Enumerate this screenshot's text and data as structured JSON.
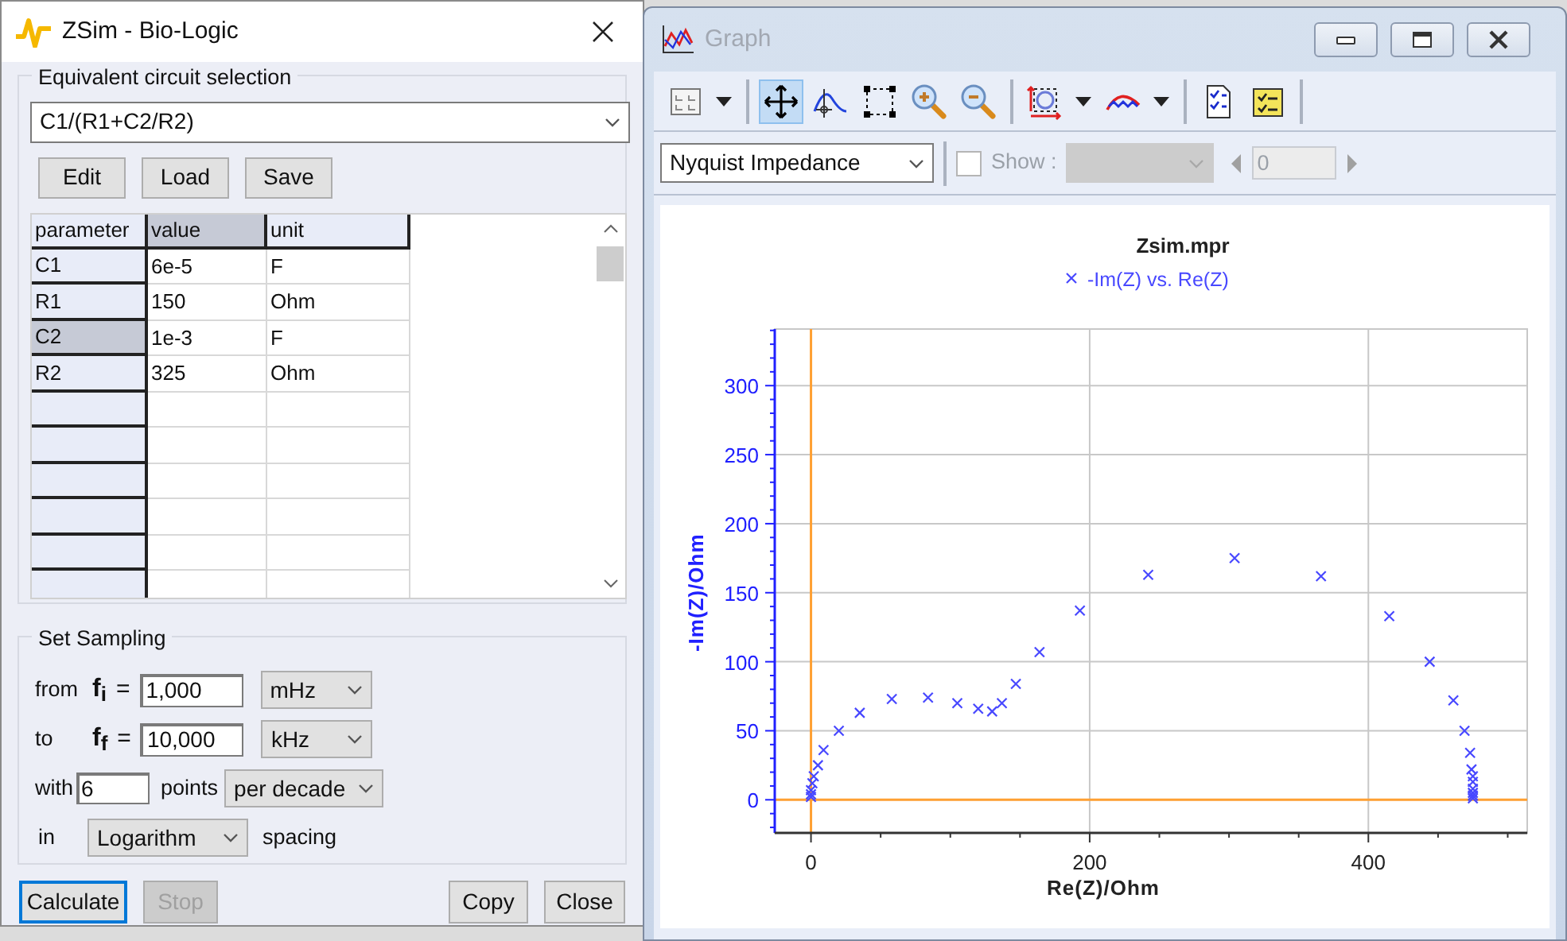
{
  "zsim_window": {
    "title": "ZSim - Bio-Logic",
    "circuit_group": {
      "label": "Equivalent circuit selection",
      "circuit": "C1/(R1+C2/R2)",
      "buttons": [
        "Edit",
        "Load",
        "Save"
      ]
    },
    "table": {
      "columns": [
        {
          "label": "parameter",
          "selected": false
        },
        {
          "label": "value",
          "selected": true
        },
        {
          "label": "unit",
          "selected": false
        }
      ],
      "rows": [
        {
          "parameter": "C1",
          "value": "6e-5",
          "unit": "F",
          "selected": false
        },
        {
          "parameter": "R1",
          "value": "150",
          "unit": "Ohm",
          "selected": false
        },
        {
          "parameter": "C2",
          "value": "1e-3",
          "unit": "F",
          "selected": true
        },
        {
          "parameter": "R2",
          "value": "325",
          "unit": "Ohm",
          "selected": false
        }
      ]
    },
    "sampling": {
      "label": "Set Sampling",
      "frequency_rows": [
        {
          "label": "from",
          "variable": "f",
          "index": "i",
          "equals": "=",
          "value": "1,000",
          "unit": "mHz"
        },
        {
          "label": "to",
          "variable": "f",
          "index": "f",
          "equals": "=",
          "value": "10,000",
          "unit": "kHz"
        }
      ],
      "points_row": {
        "label": "with",
        "value": "6",
        "unit_label": "points",
        "mode": "per decade"
      },
      "spacing_row": {
        "label": "in",
        "value": "Logarithm",
        "suffix": "spacing"
      }
    },
    "footer_buttons": [
      {
        "label": "Calculate",
        "focused": true,
        "disabled": false
      },
      {
        "label": "Stop",
        "focused": false,
        "disabled": true
      },
      {
        "label": "Copy",
        "focused": false,
        "disabled": false
      },
      {
        "label": "Close",
        "focused": false,
        "disabled": false
      }
    ]
  },
  "graph_window": {
    "title": "Graph",
    "tool_groups": [
      [
        {
          "kind": "layout",
          "dropdown": true,
          "selected": false
        }
      ],
      [
        {
          "kind": "move",
          "dropdown": false,
          "selected": true
        },
        {
          "kind": "cursor",
          "dropdown": false,
          "selected": false
        },
        {
          "kind": "select",
          "dropdown": false,
          "selected": false
        },
        {
          "kind": "zoom_in",
          "dropdown": false,
          "selected": false
        },
        {
          "kind": "zoom_out",
          "dropdown": false,
          "selected": false
        }
      ],
      [
        {
          "kind": "autoscale",
          "dropdown": true,
          "selected": false
        },
        {
          "kind": "fit",
          "dropdown": true,
          "selected": false
        }
      ],
      [
        {
          "kind": "report",
          "dropdown": false,
          "selected": false
        },
        {
          "kind": "checklist",
          "dropdown": false,
          "selected": false
        }
      ]
    ],
    "plot_type": "Nyquist Impedance",
    "show": {
      "label": "Show :",
      "checked": false
    },
    "show_spinner": {
      "value": "0",
      "disabled": true
    },
    "chart": {
      "chart_data": {
        "type": "scatter",
        "title": "Zsim.mpr",
        "xlabel": "Re(Z)/Ohm",
        "ylabel": "-Im(Z)/Ohm",
        "x": [
          0,
          0,
          0,
          1,
          2,
          5,
          9,
          20,
          35,
          58,
          84,
          105,
          120,
          130,
          137,
          147,
          164,
          193,
          242,
          304,
          366,
          415,
          444,
          461,
          469,
          473,
          474,
          475,
          475,
          475,
          475,
          475,
          475
        ],
        "series": [
          {
            "name": "-Im(Z) vs. Re(Z)",
            "color": "#4848ff",
            "values": [
              2,
              4,
              7,
              12,
              17,
              25,
              36,
              50,
              63,
              73,
              74,
              70,
              66,
              64,
              70,
              84,
              107,
              137,
              163,
              175,
              162,
              133,
              100,
              72,
              50,
              34,
              22,
              17,
              13,
              8,
              5,
              3,
              1
            ]
          }
        ],
        "grid": true,
        "xlim": [
          -26,
          514
        ],
        "ylim": [
          -24,
          341
        ],
        "xticks": [
          0,
          200,
          400
        ],
        "yticks": [
          0,
          50,
          100,
          150,
          200,
          250,
          300
        ]
      }
    }
  }
}
